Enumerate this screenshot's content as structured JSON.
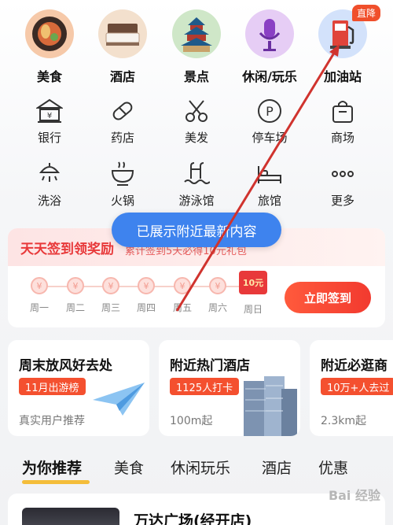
{
  "categories": [
    {
      "label": "美食",
      "icon": "food-plate-icon",
      "bg": "#f6c9a9"
    },
    {
      "label": "酒店",
      "icon": "hotel-bed-icon",
      "bg": "#f3e0cd"
    },
    {
      "label": "景点",
      "icon": "temple-icon",
      "bg": "#cfe7c8"
    },
    {
      "label": "休闲/玩乐",
      "icon": "microphone-icon",
      "bg": "#e6cdf5"
    },
    {
      "label": "加油站",
      "icon": "gas-pump-icon",
      "bg": "#d3e2fb",
      "badge": "直降"
    }
  ],
  "grid_row1": [
    {
      "label": "银行",
      "icon": "bank-icon"
    },
    {
      "label": "药店",
      "icon": "pill-icon"
    },
    {
      "label": "美发",
      "icon": "scissors-icon"
    },
    {
      "label": "停车场",
      "icon": "parking-icon"
    },
    {
      "label": "商场",
      "icon": "shopping-bag-icon"
    }
  ],
  "grid_row2": [
    {
      "label": "洗浴",
      "icon": "shower-icon"
    },
    {
      "label": "火锅",
      "icon": "hotpot-icon"
    },
    {
      "label": "游泳馆",
      "icon": "swimming-icon"
    },
    {
      "label": "旅馆",
      "icon": "bed-icon"
    },
    {
      "label": "更多",
      "icon": "more-dots-icon"
    }
  ],
  "toast": "已展示附近最新内容",
  "signin": {
    "title": "天天签到领奖励",
    "subtitle": "累计签到5天必得10元礼包",
    "days": [
      "周一",
      "周二",
      "周三",
      "周四",
      "周五",
      "周六"
    ],
    "last_day": "周日",
    "coin_symbol": "¥",
    "gift_label": "10元",
    "button": "立即签到"
  },
  "features": [
    {
      "title": "周末放风好去处",
      "tag": "11月出游榜",
      "sub": "真实用户推荐"
    },
    {
      "title": "附近热门酒店",
      "tag": "1125人打卡",
      "sub": "100m起"
    },
    {
      "title": "附近必逛商",
      "tag": "10万+人去过",
      "sub": "2.3km起"
    }
  ],
  "tabs": [
    "为你推荐",
    "美食",
    "休闲玩乐",
    "酒店",
    "优惠"
  ],
  "recommend": {
    "title": "万达广场(经开店)"
  },
  "watermark": "Bai 经验",
  "colors": {
    "accent": "#f4502f",
    "toast": "#3e83ee",
    "arrow": "#d0332e"
  }
}
